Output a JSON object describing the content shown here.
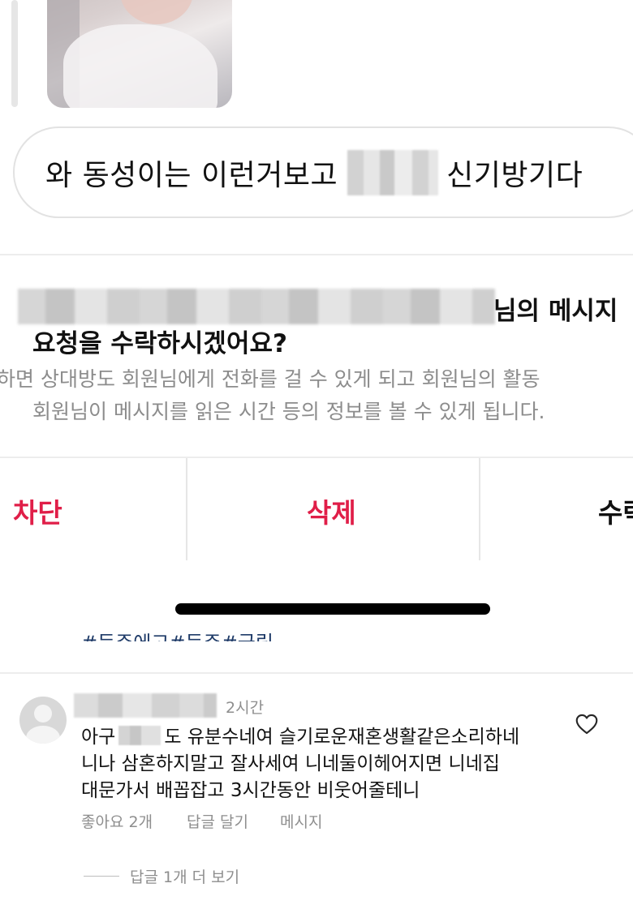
{
  "message": {
    "text_before": "와 동성이는 이런거보고",
    "text_after": "신기방기다"
  },
  "request": {
    "title_suffix": "님의 메시지",
    "title_line2": "요청을 수락하시겠어요?",
    "description_line1": "하면 상대방도 회원님에게 전화를 걸 수 있게 되고 회원님의 활동",
    "description_line2": "회원님이 메시지를 읽은 시간 등의 정보를 볼 수 있게 됩니다."
  },
  "actions": {
    "block": "차단",
    "delete": "삭제",
    "accept": "수락"
  },
  "post": {
    "hashtags": "#등주에고#등주#국립"
  },
  "comment": {
    "time": "2시간",
    "line1_before": "아구",
    "line1_after": "도 유분수네여 슬기로운재혼생활같은소리하네",
    "line2": "니나 삼혼하지말고 잘사세여 니네둘이헤어지면 니네집",
    "line3": "대문가서 배꼽잡고 3시간동안 비웃어줄테니",
    "likes": "좋아요 2개",
    "reply_label": "답글 달기",
    "message_label": "메시지",
    "view_more_replies": "답글 1개 더 보기"
  },
  "icons": {
    "like": "heart-outline-icon",
    "avatar": "default-avatar-icon"
  },
  "colors": {
    "destructive": "#e01e48",
    "muted": "#8e8e8e"
  }
}
